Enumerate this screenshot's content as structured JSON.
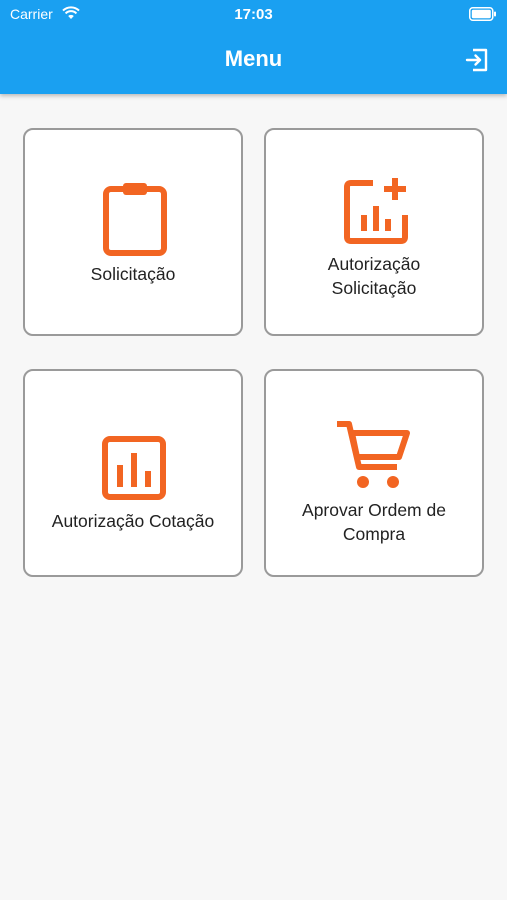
{
  "status_bar": {
    "carrier": "Carrier",
    "time": "17:03"
  },
  "header": {
    "title": "Menu",
    "logout_icon": "logout-icon"
  },
  "menu": {
    "items": [
      {
        "line1": "Solicitação",
        "line2": "",
        "icon": "clipboard-icon"
      },
      {
        "line1": "Autorização",
        "line2": "Solicitação",
        "icon": "chart-add-icon"
      },
      {
        "line1": "Autorização Cotação",
        "line2": "",
        "icon": "bar-chart-icon"
      },
      {
        "line1": "Aprovar Ordem de",
        "line2": "Compra",
        "icon": "shopping-cart-icon"
      }
    ]
  },
  "colors": {
    "header": "#1aa0f1",
    "accent": "#f26522"
  }
}
